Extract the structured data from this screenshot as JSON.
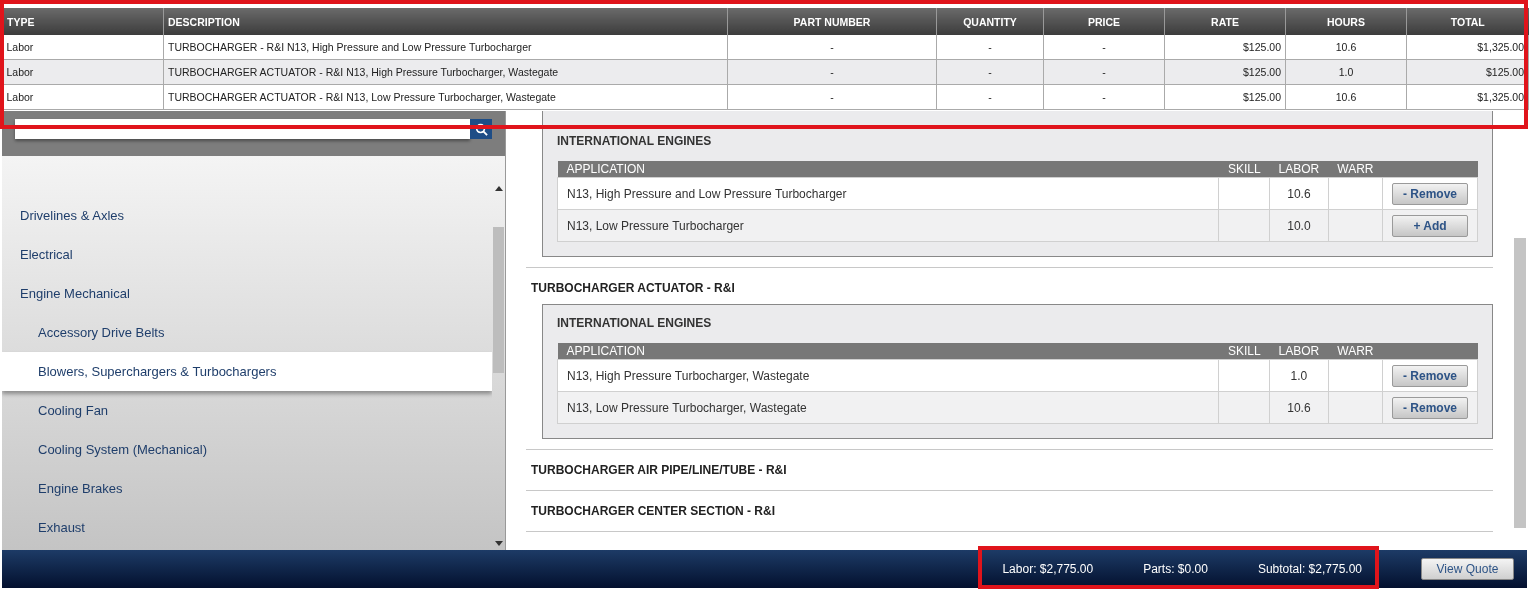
{
  "quote_table": {
    "columns": [
      "TYPE",
      "DESCRIPTION",
      "PART NUMBER",
      "QUANTITY",
      "PRICE",
      "RATE",
      "HOURS",
      "TOTAL"
    ],
    "rows": [
      {
        "type": "Labor",
        "description": "TURBOCHARGER - R&I N13, High Pressure and Low Pressure Turbocharger",
        "part_number": "-",
        "quantity": "-",
        "price": "-",
        "rate": "$125.00",
        "hours": "10.6",
        "total": "$1,325.00"
      },
      {
        "type": "Labor",
        "description": "TURBOCHARGER ACTUATOR - R&I N13, High Pressure Turbocharger, Wastegate",
        "part_number": "-",
        "quantity": "-",
        "price": "-",
        "rate": "$125.00",
        "hours": "1.0",
        "total": "$125.00"
      },
      {
        "type": "Labor",
        "description": "TURBOCHARGER ACTUATOR - R&I N13, Low Pressure Turbocharger, Wastegate",
        "part_number": "-",
        "quantity": "-",
        "price": "-",
        "rate": "$125.00",
        "hours": "10.6",
        "total": "$1,325.00"
      }
    ]
  },
  "sidebar": {
    "items": [
      {
        "label": "Drivelines & Axles",
        "selected": false
      },
      {
        "label": "Electrical",
        "selected": false
      },
      {
        "label": "Engine Mechanical",
        "selected": false,
        "children": [
          {
            "label": "Accessory Drive Belts",
            "selected": false
          },
          {
            "label": "Blowers, Superchargers & Turbochargers",
            "selected": true
          },
          {
            "label": "Cooling Fan",
            "selected": false
          },
          {
            "label": "Cooling System (Mechanical)",
            "selected": false
          },
          {
            "label": "Engine Brakes",
            "selected": false
          },
          {
            "label": "Exhaust",
            "selected": false
          }
        ]
      }
    ]
  },
  "operations": [
    {
      "groups": [
        {
          "name": "INTERNATIONAL ENGINES",
          "columns": [
            "APPLICATION",
            "SKILL",
            "LABOR",
            "WARR"
          ],
          "rows": [
            {
              "application": "N13, High Pressure and Low Pressure Turbocharger",
              "labor": "10.6",
              "action": "- Remove"
            },
            {
              "application": "N13, Low Pressure Turbocharger",
              "labor": "10.0",
              "action": "+ Add"
            }
          ]
        }
      ]
    },
    {
      "title": "TURBOCHARGER ACTUATOR - R&I",
      "groups": [
        {
          "name": "INTERNATIONAL ENGINES",
          "columns": [
            "APPLICATION",
            "SKILL",
            "LABOR",
            "WARR"
          ],
          "rows": [
            {
              "application": "N13, High Pressure Turbocharger, Wastegate",
              "labor": "1.0",
              "action": "- Remove"
            },
            {
              "application": "N13, Low Pressure Turbocharger, Wastegate",
              "labor": "10.6",
              "action": "- Remove"
            }
          ]
        }
      ]
    },
    {
      "title": "TURBOCHARGER AIR PIPE/LINE/TUBE - R&I"
    },
    {
      "title": "TURBOCHARGER CENTER SECTION - R&I"
    }
  ],
  "footer": {
    "totals": [
      "Labor: $2,775.00",
      "Parts: $0.00",
      "Subtotal: $2,775.00"
    ],
    "button": "View Quote"
  }
}
